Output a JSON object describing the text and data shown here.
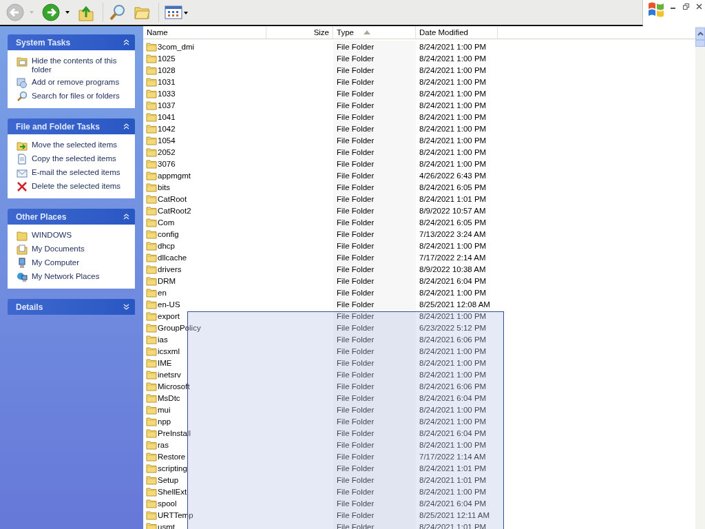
{
  "toolbar": {
    "back": {
      "disabled": true
    },
    "forward": {
      "disabled": false
    }
  },
  "sidebar": [
    {
      "title": "System Tasks",
      "expanded": true,
      "items": [
        "Hide the contents of this folder",
        "Add or remove programs",
        "Search for files or folders"
      ]
    },
    {
      "title": "File and Folder Tasks",
      "expanded": true,
      "items": [
        "Move the selected items",
        "Copy the selected items",
        "E-mail the selected items",
        "Delete the selected items"
      ]
    },
    {
      "title": "Other Places",
      "expanded": true,
      "items": [
        "WINDOWS",
        "My Documents",
        "My Computer",
        "My Network Places"
      ]
    },
    {
      "title": "Details",
      "expanded": false
    }
  ],
  "table": {
    "columns": [
      {
        "label": "Name",
        "sorted": false
      },
      {
        "label": "Size",
        "sorted": false
      },
      {
        "label": "Type",
        "sorted": true
      },
      {
        "label": "Date Modified",
        "sorted": false
      }
    ],
    "rows": [
      {
        "name": "3com_dmi",
        "type": "File Folder",
        "date": "8/24/2021 1:00 PM"
      },
      {
        "name": "1025",
        "type": "File Folder",
        "date": "8/24/2021 1:00 PM"
      },
      {
        "name": "1028",
        "type": "File Folder",
        "date": "8/24/2021 1:00 PM"
      },
      {
        "name": "1031",
        "type": "File Folder",
        "date": "8/24/2021 1:00 PM"
      },
      {
        "name": "1033",
        "type": "File Folder",
        "date": "8/24/2021 1:00 PM"
      },
      {
        "name": "1037",
        "type": "File Folder",
        "date": "8/24/2021 1:00 PM"
      },
      {
        "name": "1041",
        "type": "File Folder",
        "date": "8/24/2021 1:00 PM"
      },
      {
        "name": "1042",
        "type": "File Folder",
        "date": "8/24/2021 1:00 PM"
      },
      {
        "name": "1054",
        "type": "File Folder",
        "date": "8/24/2021 1:00 PM"
      },
      {
        "name": "2052",
        "type": "File Folder",
        "date": "8/24/2021 1:00 PM"
      },
      {
        "name": "3076",
        "type": "File Folder",
        "date": "8/24/2021 1:00 PM"
      },
      {
        "name": "appmgmt",
        "type": "File Folder",
        "date": "4/26/2022 6:43 PM"
      },
      {
        "name": "bits",
        "type": "File Folder",
        "date": "8/24/2021 6:05 PM"
      },
      {
        "name": "CatRoot",
        "type": "File Folder",
        "date": "8/24/2021 1:01 PM"
      },
      {
        "name": "CatRoot2",
        "type": "File Folder",
        "date": "8/9/2022 10:57 AM"
      },
      {
        "name": "Com",
        "type": "File Folder",
        "date": "8/24/2021 6:05 PM"
      },
      {
        "name": "config",
        "type": "File Folder",
        "date": "7/13/2022 3:24 AM"
      },
      {
        "name": "dhcp",
        "type": "File Folder",
        "date": "8/24/2021 1:00 PM"
      },
      {
        "name": "dllcache",
        "type": "File Folder",
        "date": "7/17/2022 2:14 AM"
      },
      {
        "name": "drivers",
        "type": "File Folder",
        "date": "8/9/2022 10:38 AM"
      },
      {
        "name": "DRM",
        "type": "File Folder",
        "date": "8/24/2021 6:04 PM"
      },
      {
        "name": "en",
        "type": "File Folder",
        "date": "8/24/2021 1:00 PM"
      },
      {
        "name": "en-US",
        "type": "File Folder",
        "date": "8/25/2021 12:08 AM"
      },
      {
        "name": "export",
        "type": "File Folder",
        "date": "8/24/2021 1:00 PM"
      },
      {
        "name": "GroupPolicy",
        "type": "File Folder",
        "date": "6/23/2022 5:12 PM"
      },
      {
        "name": "ias",
        "type": "File Folder",
        "date": "8/24/2021 6:06 PM"
      },
      {
        "name": "icsxml",
        "type": "File Folder",
        "date": "8/24/2021 1:00 PM"
      },
      {
        "name": "IME",
        "type": "File Folder",
        "date": "8/24/2021 1:00 PM"
      },
      {
        "name": "inetsrv",
        "type": "File Folder",
        "date": "8/24/2021 1:00 PM"
      },
      {
        "name": "Microsoft",
        "type": "File Folder",
        "date": "8/24/2021 6:06 PM"
      },
      {
        "name": "MsDtc",
        "type": "File Folder",
        "date": "8/24/2021 6:04 PM"
      },
      {
        "name": "mui",
        "type": "File Folder",
        "date": "8/24/2021 1:00 PM"
      },
      {
        "name": "npp",
        "type": "File Folder",
        "date": "8/24/2021 1:00 PM"
      },
      {
        "name": "PreInstall",
        "type": "File Folder",
        "date": "8/24/2021 6:04 PM"
      },
      {
        "name": "ras",
        "type": "File Folder",
        "date": "8/24/2021 1:00 PM"
      },
      {
        "name": "Restore",
        "type": "File Folder",
        "date": "7/17/2022 1:14 AM"
      },
      {
        "name": "scripting",
        "type": "File Folder",
        "date": "8/24/2021 1:01 PM"
      },
      {
        "name": "Setup",
        "type": "File Folder",
        "date": "8/24/2021 1:01 PM"
      },
      {
        "name": "ShellExt",
        "type": "File Folder",
        "date": "8/24/2021 1:00 PM"
      },
      {
        "name": "spool",
        "type": "File Folder",
        "date": "8/24/2021 6:04 PM"
      },
      {
        "name": "URTTemp",
        "type": "File Folder",
        "date": "8/25/2021 12:11 AM"
      },
      {
        "name": "usmt",
        "type": "File Folder",
        "date": "8/24/2021 1:01 PM"
      }
    ]
  }
}
